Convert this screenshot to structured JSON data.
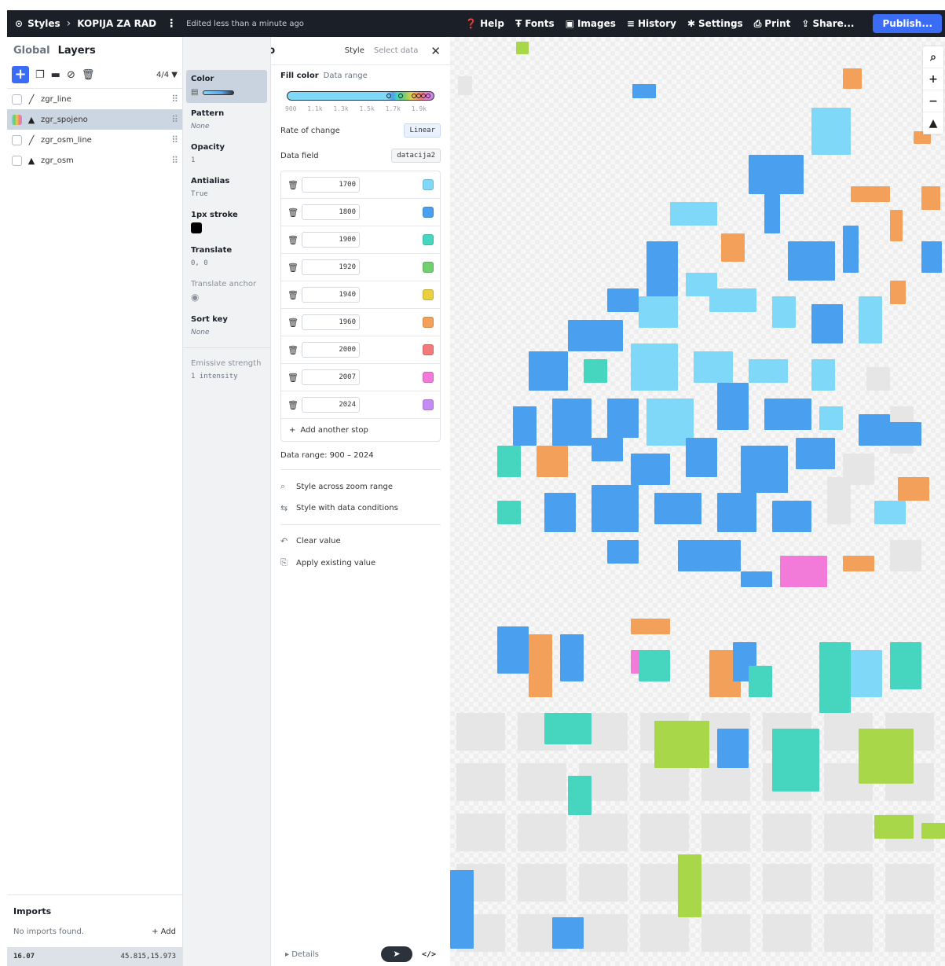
{
  "topbar": {
    "styles_label": "Styles",
    "doc_title": "KOPIJA ZA RAD",
    "edited": "Edited less than a minute ago",
    "nav": [
      {
        "label": "Help",
        "icon": "help-icon"
      },
      {
        "label": "Fonts",
        "icon": "fonts-icon"
      },
      {
        "label": "Images",
        "icon": "images-icon"
      },
      {
        "label": "History",
        "icon": "history-icon"
      },
      {
        "label": "Settings",
        "icon": "settings-icon"
      },
      {
        "label": "Print",
        "icon": "print-icon"
      },
      {
        "label": "Share...",
        "icon": "share-icon"
      }
    ],
    "publish": "Publish..."
  },
  "layers": {
    "tabs": [
      "Global",
      "Layers"
    ],
    "count": "4/4",
    "items": [
      {
        "name": "zgr_line",
        "type": "line"
      },
      {
        "name": "zgr_spojeno",
        "type": "fill"
      },
      {
        "name": "zgr_osm_line",
        "type": "line"
      },
      {
        "name": "zgr_osm",
        "type": "fill"
      }
    ],
    "imports_title": "Imports",
    "imports_empty": "No imports found.",
    "imports_add": "+ Add",
    "zoom": "16.07",
    "coords": "45.815,15.973"
  },
  "panel": {
    "layer_name": "zgr_spojeno",
    "tab_style": "Style",
    "tab_select": "Select data"
  },
  "props": {
    "color": "Color",
    "pattern": "Pattern",
    "pattern_val": "None",
    "opacity": "Opacity",
    "opacity_val": "1",
    "antialias": "Antialias",
    "antialias_val": "True",
    "stroke": "1px stroke",
    "translate": "Translate",
    "translate_val": "0, 0",
    "translate_anchor": "Translate anchor",
    "sort_key": "Sort key",
    "sort_key_val": "None",
    "emissive": "Emissive strength",
    "emissive_val": "1 intensity"
  },
  "editor": {
    "fill_color": "Fill color",
    "data_range_label": "Data range",
    "ticks": [
      "900",
      "1.1k",
      "1.3k",
      "1.5k",
      "1.7k",
      "1.9k"
    ],
    "rate_label": "Rate of change",
    "rate_value": "Linear",
    "field_label": "Data field",
    "field_value": "datacija2",
    "stops": [
      {
        "value": "1700",
        "color": "#80d8f8"
      },
      {
        "value": "1800",
        "color": "#4aa0ee"
      },
      {
        "value": "1900",
        "color": "#46d6c0"
      },
      {
        "value": "1920",
        "color": "#70d070"
      },
      {
        "value": "1940",
        "color": "#e8d040"
      },
      {
        "value": "1960",
        "color": "#f2a05a"
      },
      {
        "value": "2000",
        "color": "#f27a7a"
      },
      {
        "value": "2007",
        "color": "#f27ad8"
      },
      {
        "value": "2024",
        "color": "#c48bf5"
      }
    ],
    "add_stop": "Add another stop",
    "data_range_text": "Data range: 900 – 2024",
    "zoom_range": "Style across zoom range",
    "data_conditions": "Style with data conditions",
    "clear_value": "Clear value",
    "apply_value": "Apply existing value",
    "details": "Details"
  },
  "colors": {
    "light_blue": "#80d8f8",
    "blue": "#4aa0ee",
    "teal": "#46d6c0",
    "green": "#a8d84a",
    "orange": "#f2a05a",
    "pink": "#f27ad8",
    "gray": "#e6e6e6"
  }
}
